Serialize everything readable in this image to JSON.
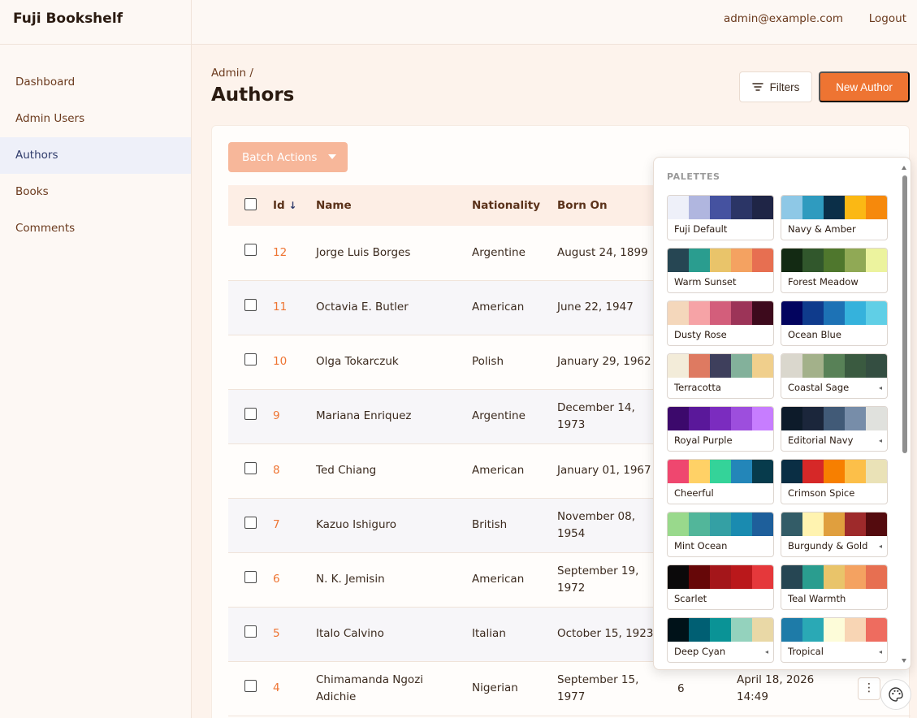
{
  "app": {
    "title": "Fuji Bookshelf"
  },
  "sidebar": {
    "items": [
      {
        "label": "Dashboard"
      },
      {
        "label": "Admin Users"
      },
      {
        "label": "Authors",
        "active": true
      },
      {
        "label": "Books"
      },
      {
        "label": "Comments"
      }
    ]
  },
  "topbar": {
    "email": "admin@example.com",
    "logout": "Logout"
  },
  "header": {
    "breadcrumb": "Admin /",
    "title": "Authors",
    "filters_label": "Filters",
    "new_label": "New Author"
  },
  "batch_actions": "Batch Actions",
  "table": {
    "columns": [
      "Id",
      "Name",
      "Nationality",
      "Born On"
    ],
    "rows": [
      {
        "id": "12",
        "name": "Jorge Luis Borges",
        "nationality": "Argentine",
        "born": "August 24, 1899"
      },
      {
        "id": "11",
        "name": "Octavia E. Butler",
        "nationality": "American",
        "born": "June 22, 1947"
      },
      {
        "id": "10",
        "name": "Olga Tokarczuk",
        "nationality": "Polish",
        "born": "January 29, 1962"
      },
      {
        "id": "9",
        "name": "Mariana Enriquez",
        "nationality": "Argentine",
        "born": "December 14, 1973"
      },
      {
        "id": "8",
        "name": "Ted Chiang",
        "nationality": "American",
        "born": "January 01, 1967"
      },
      {
        "id": "7",
        "name": "Kazuo Ishiguro",
        "nationality": "British",
        "born": "November 08, 1954"
      },
      {
        "id": "6",
        "name": "N. K. Jemisin",
        "nationality": "American",
        "born": "September 19, 1972"
      },
      {
        "id": "5",
        "name": "Italo Calvino",
        "nationality": "Italian",
        "born": "October 15, 1923"
      },
      {
        "id": "4",
        "name": "Chimamanda Ngozi Adichie",
        "nationality": "Nigerian",
        "born": "September 15, 1977",
        "extra": "6",
        "updated": "April 18, 2026 14:49"
      }
    ]
  },
  "palettes": {
    "title": "PALETTES",
    "items": [
      {
        "name": "Fuji Default",
        "colors": [
          "#eef0f9",
          "#b0b6df",
          "#4552a0",
          "#2b3566",
          "#1f2546"
        ]
      },
      {
        "name": "Navy & Amber",
        "colors": [
          "#8ec8e6",
          "#2f9bbf",
          "#0b2f48",
          "#fbb814",
          "#f6890c"
        ]
      },
      {
        "name": "Warm Sunset",
        "colors": [
          "#264653",
          "#2a9d8f",
          "#e9c46a",
          "#f4a261",
          "#e76f51"
        ]
      },
      {
        "name": "Forest Meadow",
        "colors": [
          "#132a13",
          "#31572c",
          "#4f772d",
          "#90a955",
          "#ecf39e"
        ]
      },
      {
        "name": "Dusty Rose",
        "colors": [
          "#f4d7bb",
          "#f6a3a6",
          "#d35e7b",
          "#9c3458",
          "#3d0a1c"
        ]
      },
      {
        "name": "Ocean Blue",
        "colors": [
          "#03045e",
          "#0f3b8c",
          "#1d72b5",
          "#35b2dc",
          "#60cfe6"
        ]
      },
      {
        "name": "Terracotta",
        "colors": [
          "#f3ecd9",
          "#de7a61",
          "#3e3f5c",
          "#83b19b",
          "#f0cf8c"
        ]
      },
      {
        "name": "Coastal Sage",
        "colors": [
          "#dad7cd",
          "#a3b18a",
          "#588157",
          "#3a5a40",
          "#344e41"
        ],
        "tag": true
      },
      {
        "name": "Royal Purple",
        "colors": [
          "#3c096c",
          "#5a189a",
          "#7b2cbf",
          "#9d4edd",
          "#c77dff"
        ]
      },
      {
        "name": "Editorial Navy",
        "colors": [
          "#0d1b2a",
          "#1b263b",
          "#415a77",
          "#778da9",
          "#e0e1dd"
        ],
        "tag": true
      },
      {
        "name": "Cheerful",
        "colors": [
          "#ef476f",
          "#ffd166",
          "#34d399",
          "#2386b9",
          "#073b4c"
        ]
      },
      {
        "name": "Crimson Spice",
        "colors": [
          "#0a2e44",
          "#d62828",
          "#f77f00",
          "#fcbf49",
          "#eae2b7"
        ]
      },
      {
        "name": "Mint Ocean",
        "colors": [
          "#99d98c",
          "#52b69a",
          "#34a0a4",
          "#1a8bb0",
          "#1e5f9b"
        ]
      },
      {
        "name": "Burgundy & Gold",
        "colors": [
          "#335c67",
          "#fff3b0",
          "#e09f3e",
          "#9e2a2b",
          "#540b0e"
        ],
        "tag": true
      },
      {
        "name": "Scarlet",
        "colors": [
          "#0b090a",
          "#660708",
          "#a4161a",
          "#ba181b",
          "#e5383b"
        ]
      },
      {
        "name": "Teal Warmth",
        "colors": [
          "#264653",
          "#2a9d8f",
          "#e9c46a",
          "#f4a261",
          "#e76f51"
        ]
      },
      {
        "name": "Deep Cyan",
        "colors": [
          "#001219",
          "#005f73",
          "#0a9396",
          "#94d2bd",
          "#e9d8a6"
        ],
        "tag": true
      },
      {
        "name": "Tropical",
        "colors": [
          "#1e7ba8",
          "#2aa9b5",
          "#fdfcd9",
          "#f8d5b4",
          "#ee6c5f"
        ],
        "tag": true
      }
    ]
  },
  "colors": {
    "accent": "#ee7432",
    "sidebar_active_bg": "#eef0f9",
    "header_row_bg": "#fdeee5"
  }
}
